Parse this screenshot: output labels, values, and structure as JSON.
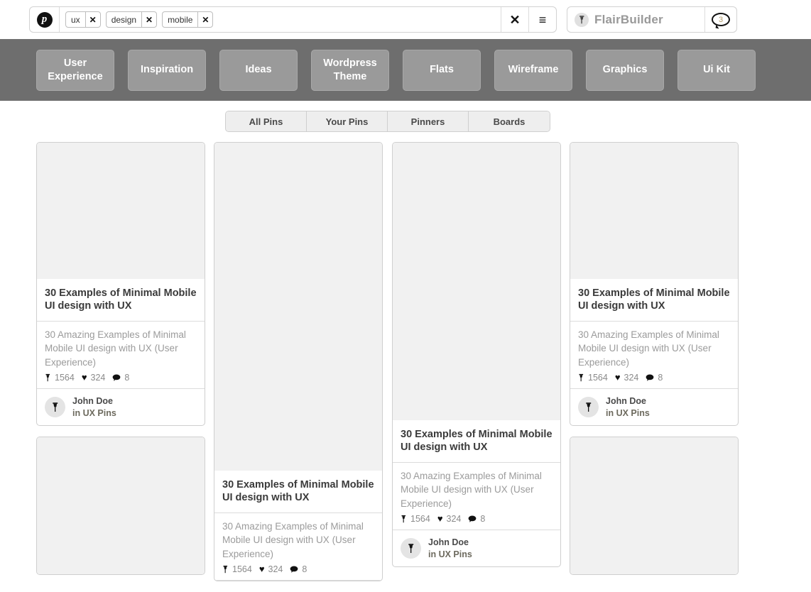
{
  "topbar": {
    "logo_icon": "pinterest-logo-icon",
    "logo_letter": "p",
    "tags": [
      {
        "label": "ux",
        "remove_icon": "close-icon",
        "remove_label": "✕"
      },
      {
        "label": "design",
        "remove_icon": "close-icon",
        "remove_label": "✕"
      },
      {
        "label": "mobile",
        "remove_icon": "close-icon",
        "remove_label": "✕"
      }
    ],
    "clear_icon": "close-icon",
    "clear_label": "✕",
    "menu_icon": "hamburger-menu-icon",
    "menu_label": "≡",
    "user": {
      "avatar_icon": "pushpin-icon",
      "avatar_glyph": "✐",
      "name": "FlairBuilder",
      "notification_icon": "speech-bubble-icon",
      "notification_count": "3"
    }
  },
  "nav": {
    "items": [
      {
        "label": "User Experience"
      },
      {
        "label": "Inspiration"
      },
      {
        "label": "Ideas"
      },
      {
        "label": "Wordpress Theme"
      },
      {
        "label": "Flats"
      },
      {
        "label": "Wireframe"
      },
      {
        "label": "Graphics"
      },
      {
        "label": "Ui Kit"
      }
    ]
  },
  "tabs": {
    "items": [
      {
        "label": "All Pins"
      },
      {
        "label": "Your Pins"
      },
      {
        "label": "Pinners"
      },
      {
        "label": "Boards"
      }
    ]
  },
  "pin": {
    "title": "30 Examples of  Minimal Mobile UI design with UX",
    "description": "30 Amazing Examples of Minimal Mobile UI design with UX (User Experience)",
    "pin_icon": "pushpin-icon",
    "pin_glyph": "✐",
    "pin_count": "1564",
    "heart_icon": "heart-icon",
    "heart_glyph": "♥",
    "heart_count": "324",
    "comment_icon": "speech-bubble-icon",
    "comment_glyph": "●",
    "comment_count": "8",
    "author_avatar_icon": "pushpin-icon",
    "author_avatar_glyph": "✐",
    "author_name": "John Doe",
    "author_board": "in UX Pins"
  },
  "colors": {
    "nav_band": "#6e6e6e",
    "nav_button": "#9a9a9a",
    "image_placeholder": "#f1f1f1",
    "card_border": "#cfcfcf",
    "title_text": "#3a3a3a",
    "desc_text": "#9b9b9b"
  }
}
